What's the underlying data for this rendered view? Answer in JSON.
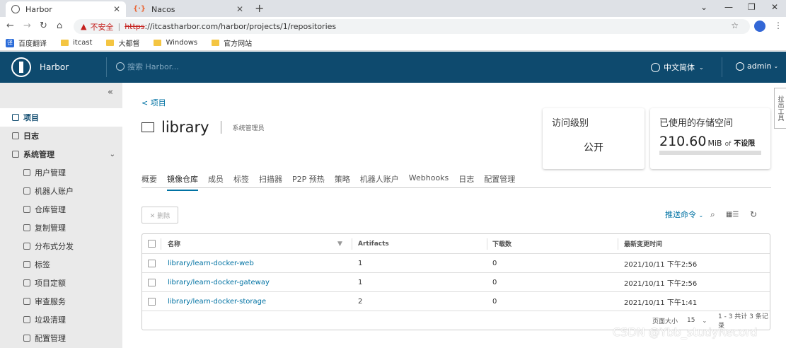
{
  "browser": {
    "tabs": [
      {
        "title": "Harbor"
      },
      {
        "title": "Nacos",
        "icon": "{·}"
      }
    ],
    "omnibox": {
      "warning_label": "不安全",
      "url_scheme": "https",
      "url_rest": "://itcastharbor.com/harbor/projects/1/repositories"
    },
    "bookmarks": [
      {
        "label": "百度翻译",
        "icon": "译"
      },
      {
        "label": "itcast"
      },
      {
        "label": "大都督"
      },
      {
        "label": "Windows"
      },
      {
        "label": "官方网站"
      }
    ]
  },
  "header": {
    "app_name": "Harbor",
    "search_placeholder": "搜索 Harbor...",
    "language": "中文简体",
    "user": "admin"
  },
  "sidebar": {
    "items": [
      {
        "label": "项目",
        "active": true
      },
      {
        "label": "日志"
      },
      {
        "label": "系统管理",
        "expandable": true
      },
      {
        "label": "用户管理",
        "sub": true
      },
      {
        "label": "机器人账户",
        "sub": true
      },
      {
        "label": "仓库管理",
        "sub": true
      },
      {
        "label": "复制管理",
        "sub": true
      },
      {
        "label": "分布式分发",
        "sub": true
      },
      {
        "label": "标签",
        "sub": true
      },
      {
        "label": "项目定额",
        "sub": true
      },
      {
        "label": "审查服务",
        "sub": true
      },
      {
        "label": "垃圾清理",
        "sub": true
      },
      {
        "label": "配置管理",
        "sub": true
      }
    ]
  },
  "project": {
    "back_label": "< 项目",
    "name": "library",
    "role": "系统管理员",
    "access_card": {
      "title": "访问级别",
      "value": "公开"
    },
    "storage_card": {
      "title": "已使用的存储空间",
      "used": "210.60",
      "unit": "MiB",
      "of": "of",
      "limit": "不设限"
    }
  },
  "tabs": [
    "概要",
    "镜像仓库",
    "成员",
    "标签",
    "扫描器",
    "P2P 预热",
    "策略",
    "机器人账户",
    "Webhooks",
    "日志",
    "配置管理"
  ],
  "toolbar": {
    "delete_label": "✕ 删除",
    "push_label": "推送命令"
  },
  "table": {
    "columns": [
      "名称",
      "Artifacts",
      "下载数",
      "最新变更时间"
    ],
    "rows": [
      {
        "name": "library/learn-docker-web",
        "artifacts": "1",
        "pulls": "0",
        "time": "2021/10/11 下午2:56"
      },
      {
        "name": "library/learn-docker-gateway",
        "artifacts": "1",
        "pulls": "0",
        "time": "2021/10/11 下午2:56"
      },
      {
        "name": "library/learn-docker-storage",
        "artifacts": "2",
        "pulls": "0",
        "time": "2021/10/11 下午1:41"
      }
    ],
    "footer": {
      "page_size_label": "页面大小",
      "page_size": "15",
      "summary": "1 - 3 共计 3 条记录"
    }
  },
  "side_tab": "拉出工具",
  "watermark": "CSDN @Ybb_studyRecord",
  "colors": {
    "header": "#0e4a6e",
    "link": "#0072a3",
    "sidebar": "#eaeaea"
  }
}
